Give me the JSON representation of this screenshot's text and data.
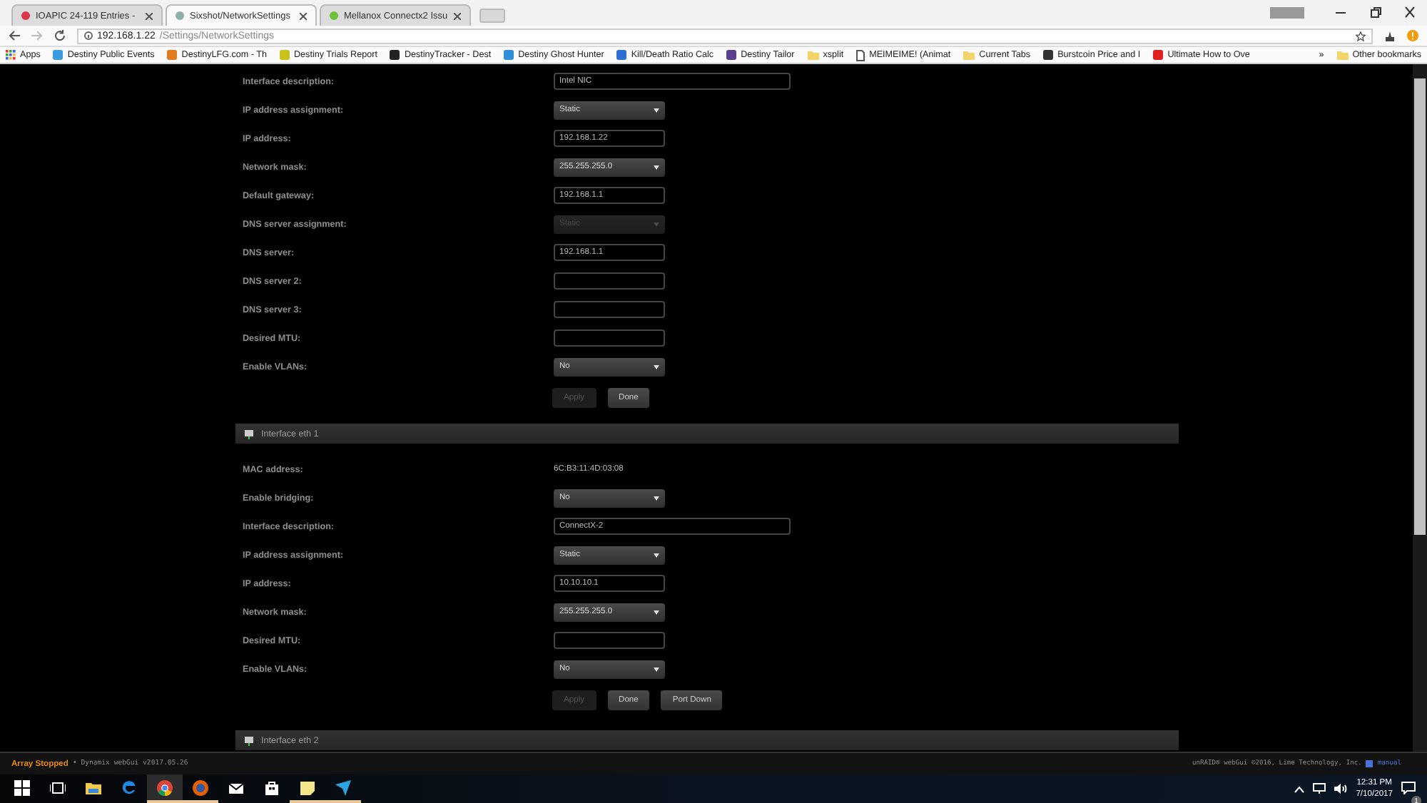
{
  "browser": {
    "tabs": [
      {
        "title": "IOAPIC 24-119 Entries -",
        "selected": false,
        "color": "#d9364a"
      },
      {
        "title": "Sixshot/NetworkSettings",
        "selected": true,
        "color": "#8fb0a8"
      },
      {
        "title": "Mellanox Connectx2 Issu",
        "selected": false,
        "color": "#6fbf3a"
      }
    ],
    "address": {
      "host": "192.168.1.22",
      "path": "/Settings/NetworkSettings"
    },
    "bookmarks": [
      {
        "label": "Apps",
        "kind": "apps"
      },
      {
        "label": "Destiny Public Events",
        "kind": "site",
        "color": "#3b9be0"
      },
      {
        "label": "DestinyLFG.com - Th",
        "kind": "site",
        "color": "#e07b1f"
      },
      {
        "label": "Destiny Trials Report",
        "kind": "site",
        "color": "#c9c21a"
      },
      {
        "label": "DestinyTracker - Dest",
        "kind": "site",
        "color": "#222222"
      },
      {
        "label": "Destiny Ghost Hunter",
        "kind": "site",
        "color": "#2f8fd8"
      },
      {
        "label": "Kill/Death Ratio Calc",
        "kind": "site",
        "color": "#2e6fd1"
      },
      {
        "label": "Destiny Tailor",
        "kind": "site",
        "color": "#5a3f8f"
      },
      {
        "label": "xsplit",
        "kind": "folder"
      },
      {
        "label": "MEIMEIME! (Animat",
        "kind": "page"
      },
      {
        "label": "Current Tabs",
        "kind": "folder"
      },
      {
        "label": "Burstcoin Price and I",
        "kind": "site",
        "color": "#333333"
      },
      {
        "label": "Ultimate How to Ove",
        "kind": "site",
        "color": "#e02020"
      }
    ],
    "more": "»",
    "other_bookmarks": "Other bookmarks"
  },
  "sections": [
    {
      "rows": [
        {
          "label": "Interface description:",
          "kind": "wide",
          "value": "Intel NIC"
        },
        {
          "label": "IP address assignment:",
          "kind": "select",
          "value": "Static",
          "disabled": false
        },
        {
          "label": "IP address:",
          "kind": "text",
          "value": "192.168.1.22"
        },
        {
          "label": "Network mask:",
          "kind": "select",
          "value": "255.255.255.0",
          "disabled": false
        },
        {
          "label": "Default gateway:",
          "kind": "text",
          "value": "192.168.1.1"
        },
        {
          "label": "DNS server assignment:",
          "kind": "select",
          "value": "Static",
          "disabled": true
        },
        {
          "label": "DNS server:",
          "kind": "text",
          "value": "192.168.1.1"
        },
        {
          "label": "DNS server 2:",
          "kind": "text",
          "value": ""
        },
        {
          "label": "DNS server 3:",
          "kind": "text",
          "value": ""
        },
        {
          "label": "Desired MTU:",
          "kind": "text",
          "value": ""
        },
        {
          "label": "Enable VLANs:",
          "kind": "select",
          "value": "No",
          "disabled": false
        }
      ],
      "buttons": [
        {
          "label": "Apply",
          "disabled": true
        },
        {
          "label": "Done",
          "disabled": false
        }
      ]
    },
    {
      "title": "Interface eth 1",
      "rows": [
        {
          "label": "MAC address:",
          "kind": "static",
          "value": "6C:B3:11:4D:03:08"
        },
        {
          "label": "Enable bridging:",
          "kind": "select",
          "value": "No",
          "disabled": false
        },
        {
          "label": "Interface description:",
          "kind": "wide",
          "value": "ConnectX-2"
        },
        {
          "label": "IP address assignment:",
          "kind": "select",
          "value": "Static",
          "disabled": false
        },
        {
          "label": "IP address:",
          "kind": "text",
          "value": "10.10.10.1"
        },
        {
          "label": "Network mask:",
          "kind": "select",
          "value": "255.255.255.0",
          "disabled": false
        },
        {
          "label": "Desired MTU:",
          "kind": "text",
          "value": ""
        },
        {
          "label": "Enable VLANs:",
          "kind": "select",
          "value": "No",
          "disabled": false
        }
      ],
      "buttons": [
        {
          "label": "Apply",
          "disabled": true
        },
        {
          "label": "Done",
          "disabled": false
        },
        {
          "label": "Port Down",
          "disabled": false
        }
      ]
    },
    {
      "title": "Interface eth 2"
    }
  ],
  "footer": {
    "status": "Array Stopped",
    "version": "• Dynamix webGui v2017.05.26",
    "copyright": "unRAID® webGui ©2016, Lime Technology, Inc.",
    "manual": "manual"
  },
  "taskbar": {
    "apps": [
      {
        "kind": "windows",
        "running": false,
        "selected": false
      },
      {
        "kind": "taskview",
        "running": false,
        "selected": false
      },
      {
        "kind": "explorer",
        "running": false,
        "selected": false
      },
      {
        "kind": "edge",
        "running": false,
        "selected": false
      },
      {
        "kind": "chrome",
        "running": true,
        "selected": true
      },
      {
        "kind": "firefox",
        "running": true,
        "selected": false
      },
      {
        "kind": "mail",
        "running": false,
        "selected": false
      },
      {
        "kind": "store",
        "running": false,
        "selected": false
      },
      {
        "kind": "notes",
        "running": true,
        "selected": false
      },
      {
        "kind": "telegram",
        "running": true,
        "selected": false
      }
    ],
    "time": "12:31 PM",
    "date": "7/10/2017",
    "notifications": "1"
  }
}
